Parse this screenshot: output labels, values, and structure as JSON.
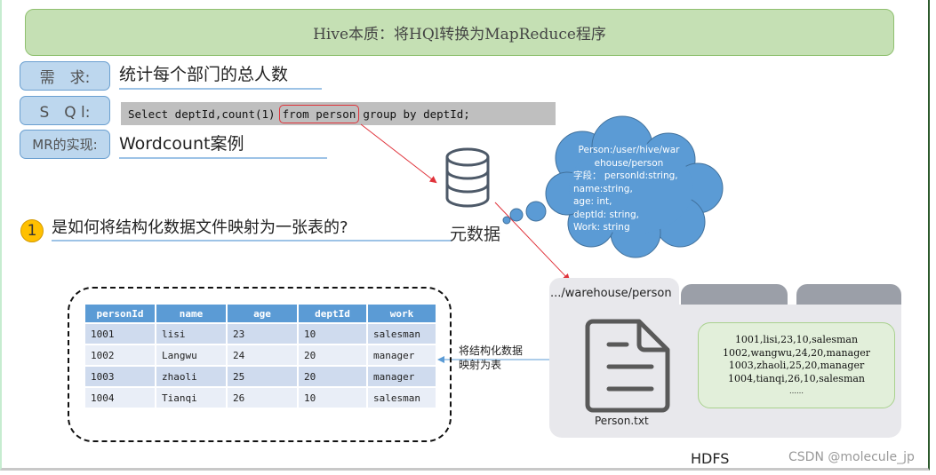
{
  "title": "Hive本质：将HQl转换为MapReduce程序",
  "rows": {
    "requirement": {
      "label": "需　求:",
      "text": "统计每个部门的总人数"
    },
    "sql": {
      "label": "S　Q l:",
      "before": "Select deptId,count(1)",
      "highlight": "from person",
      "after": "group by deptId;"
    },
    "mr": {
      "label": "MR的实现:",
      "text": "Wordcount案例"
    }
  },
  "question": {
    "number": "1",
    "text": "是如何将结构化数据文件映射为一张表的?"
  },
  "metadata": {
    "label": "元数据",
    "cloud_lines": [
      "Person:/user/hive/war",
      "ehouse/person",
      "字段：  personId:string,",
      "name:string,",
      "age: int,",
      "deptId: string,",
      "Work: string"
    ]
  },
  "table": {
    "headers": [
      "personId",
      "name",
      "age",
      "deptId",
      "work"
    ],
    "rows": [
      [
        "1001",
        "lisi",
        "23",
        "10",
        "salesman"
      ],
      [
        "1002",
        "Langwu",
        "24",
        "20",
        "manager"
      ],
      [
        "1003",
        "zhaoli",
        "25",
        "20",
        "manager"
      ],
      [
        "1004",
        "Tianqi",
        "26",
        "10",
        "salesman"
      ]
    ]
  },
  "mapping_label": [
    "将结构化数据",
    "映射为表"
  ],
  "hdfs": {
    "path": ".../warehouse/person",
    "file_name": "Person.txt",
    "file_lines": [
      "1001,lisi,23,10,salesman",
      "1002,wangwu,24,20,manager",
      "1003,zhaoli,25,20,manager",
      "1004,tianqi,26,10,salesman",
      "……"
    ],
    "caption": "HDFS"
  },
  "watermark": "CSDN @molecule_jp",
  "colors": {
    "title_bg": "#c5e0b4",
    "label_bg": "#bdd7ee",
    "header_blue": "#5b9bd5",
    "cloud_blue": "#5b9bd5",
    "highlight_red": "#e0323a",
    "badge_yellow": "#ffc000"
  }
}
